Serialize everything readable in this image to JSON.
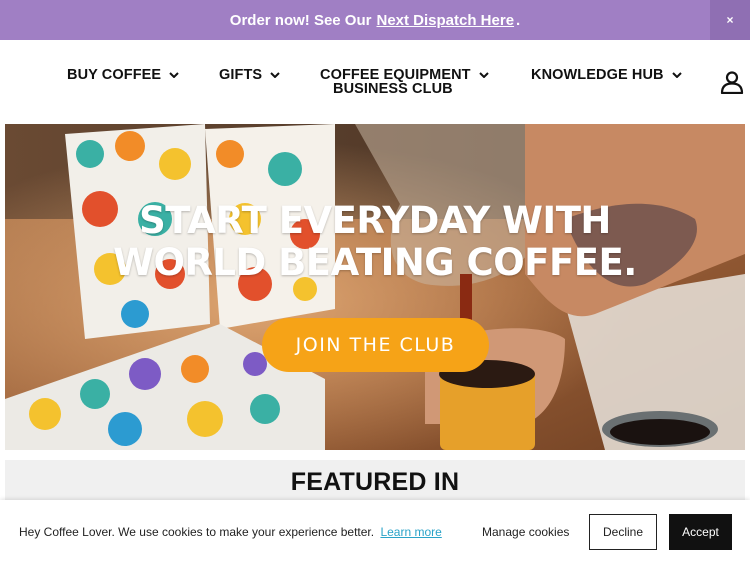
{
  "announcement": {
    "prefix": "Order now! See Our",
    "link": "Next Dispatch Here",
    "suffix": ".",
    "close": "×",
    "bg_color": "#a07fc4"
  },
  "nav": {
    "items": [
      {
        "label": "BUY COFFEE"
      },
      {
        "label": "GIFTS"
      },
      {
        "label": "COFFEE EQUIPMENT"
      },
      {
        "label": "KNOWLEDGE HUB"
      },
      {
        "label": "BUSINESS CLUB"
      }
    ],
    "account_icon": "user-icon"
  },
  "hero": {
    "title_line1": "START EVERYDAY WITH",
    "title_line2": "WORLD BEATING COFFEE.",
    "cta": "JOIN THE CLUB",
    "cta_color": "#f6a317"
  },
  "featured": {
    "title": "FEATURED IN"
  },
  "cookie": {
    "message": "Hey Coffee Lover. We use cookies to make your experience better.",
    "learn_more": "Learn more",
    "manage": "Manage cookies",
    "decline": "Decline",
    "accept": "Accept"
  }
}
